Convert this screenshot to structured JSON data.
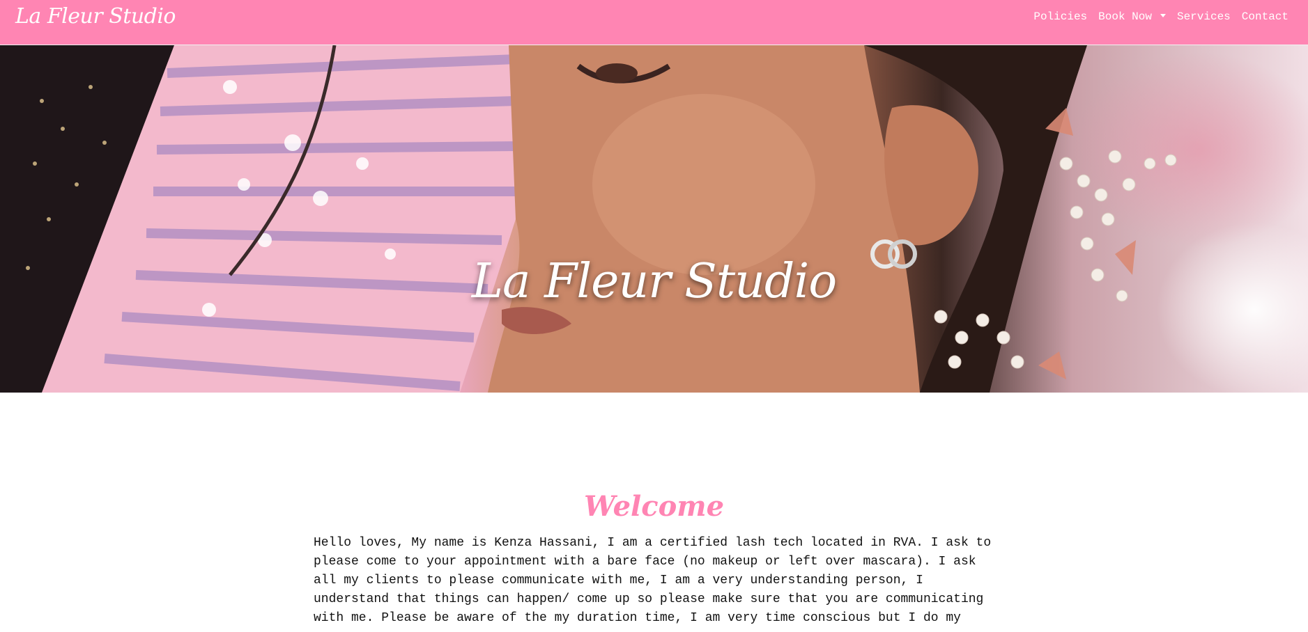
{
  "navbar": {
    "brand": "La Fleur Studio",
    "links": [
      {
        "label": "Policies"
      },
      {
        "label": "Book Now",
        "has_dropdown": true
      },
      {
        "label": "Services"
      },
      {
        "label": "Contact"
      }
    ]
  },
  "hero": {
    "title": "La Fleur Studio",
    "image_description_icon": "hero-photo"
  },
  "main": {
    "heading": "Welcome",
    "intro": "Hello loves, My name is Kenza Hassani, I am a certified lash tech located in RVA. I ask to please come to your appointment with a bare face (no makeup or left over mascara). I ask all my clients to please communicate with me, I am a very understanding person, I understand that things can happen/ come up so please make sure that you are communicating with me. Please be aware of the my duration time, I am very time conscious but I do my"
  },
  "colors": {
    "accent": "#ff85b3",
    "text": "#111111",
    "background": "#ffffff"
  }
}
